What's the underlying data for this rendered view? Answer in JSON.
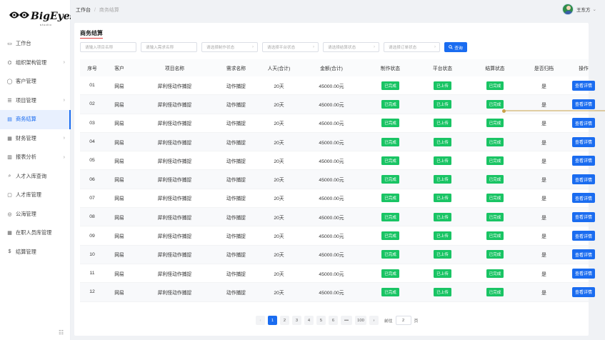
{
  "logo": {
    "text": "BigEyes",
    "sub": "studio"
  },
  "sidebar": {
    "items": [
      {
        "label": "工作台",
        "icon": "monitor-icon",
        "chev": ""
      },
      {
        "label": "组织架构管理",
        "icon": "org-icon",
        "chev": "›"
      },
      {
        "label": "客户管理",
        "icon": "user-icon",
        "chev": ""
      },
      {
        "label": "项目管理",
        "icon": "list-icon",
        "chev": "›"
      },
      {
        "label": "商务结算",
        "icon": "document-icon",
        "chev": ""
      },
      {
        "label": "财务管理",
        "icon": "finance-icon",
        "chev": "›"
      },
      {
        "label": "报表分析",
        "icon": "chart-icon",
        "chev": "›"
      },
      {
        "label": "人才入库查询",
        "icon": "search-icon",
        "chev": ""
      },
      {
        "label": "人才库管理",
        "icon": "file-icon",
        "chev": ""
      },
      {
        "label": "公海管理",
        "icon": "group-icon",
        "chev": ""
      },
      {
        "label": "在职人员库管理",
        "icon": "grid-icon",
        "chev": ""
      },
      {
        "label": "结算管理",
        "icon": "dollar-icon",
        "chev": ""
      }
    ],
    "active_index": 4
  },
  "header": {
    "breadcrumb_root": "工作台",
    "breadcrumb_sep": "/",
    "breadcrumb_current": "商务结算",
    "user_name": "王东方",
    "user_chev": "⌄"
  },
  "page": {
    "title": "商务结算"
  },
  "filters": {
    "project_name": "请输入项目名称",
    "demand_name": "请输入需求名称",
    "make_status": "请选择制作状态",
    "platform_status": "请选择平台状态",
    "settle_status": "请选择结算状态",
    "order_status": "请选择订单状态",
    "search_label": "查询"
  },
  "table": {
    "headers": [
      "序号",
      "客户",
      "项目名称",
      "需求名称",
      "人天(合计)",
      "金额(合计)",
      "制作状态",
      "平台状态",
      "结算状态",
      "是否归档",
      "操作"
    ],
    "rows": [
      [
        "01",
        "网易",
        "犀利怪动作捕捉",
        "动作捕捉",
        "20天",
        "45000.00元",
        "已完成",
        "已上传",
        "已完成",
        "是",
        "查看详情"
      ],
      [
        "02",
        "网易",
        "犀利怪动作捕捉",
        "动作捕捉",
        "20天",
        "45000.00元",
        "已完成",
        "已上传",
        "已完成",
        "是",
        "查看详情"
      ],
      [
        "03",
        "网易",
        "犀利怪动作捕捉",
        "动作捕捉",
        "20天",
        "45000.00元",
        "已完成",
        "已上传",
        "已完成",
        "是",
        "查看详情"
      ],
      [
        "04",
        "网易",
        "犀利怪动作捕捉",
        "动作捕捉",
        "20天",
        "45000.00元",
        "已完成",
        "已上传",
        "已完成",
        "是",
        "查看详情"
      ],
      [
        "05",
        "网易",
        "犀利怪动作捕捉",
        "动作捕捉",
        "20天",
        "45000.00元",
        "已完成",
        "已上传",
        "已完成",
        "是",
        "查看详情"
      ],
      [
        "06",
        "网易",
        "犀利怪动作捕捉",
        "动作捕捉",
        "20天",
        "45000.00元",
        "已完成",
        "已上传",
        "已完成",
        "是",
        "查看详情"
      ],
      [
        "07",
        "网易",
        "犀利怪动作捕捉",
        "动作捕捉",
        "20天",
        "45000.00元",
        "已完成",
        "已上传",
        "已完成",
        "是",
        "查看详情"
      ],
      [
        "08",
        "网易",
        "犀利怪动作捕捉",
        "动作捕捉",
        "20天",
        "45000.00元",
        "已完成",
        "已上传",
        "已完成",
        "是",
        "查看详情"
      ],
      [
        "09",
        "网易",
        "犀利怪动作捕捉",
        "动作捕捉",
        "20天",
        "45000.00元",
        "已完成",
        "已上传",
        "已完成",
        "是",
        "查看详情"
      ],
      [
        "10",
        "网易",
        "犀利怪动作捕捉",
        "动作捕捉",
        "20天",
        "45000.00元",
        "已完成",
        "已上传",
        "已完成",
        "是",
        "查看详情"
      ],
      [
        "11",
        "网易",
        "犀利怪动作捕捉",
        "动作捕捉",
        "20天",
        "45000.00元",
        "已完成",
        "已上传",
        "已完成",
        "是",
        "查看详情"
      ],
      [
        "12",
        "网易",
        "犀利怪动作捕捉",
        "动作捕捉",
        "20天",
        "45000.00元",
        "已完成",
        "已上传",
        "已完成",
        "是",
        "查看详情"
      ]
    ]
  },
  "pagination": {
    "prev": "‹",
    "next": "›",
    "pages": [
      "1",
      "2",
      "3",
      "4",
      "5",
      "6",
      "•••",
      "100"
    ],
    "current": "1",
    "goto_label": "前往",
    "goto_value": "2",
    "goto_suffix": "页"
  },
  "colors": {
    "accent": "#1a6cf0",
    "success": "#19c464",
    "title_underline": "#e23d3d"
  }
}
